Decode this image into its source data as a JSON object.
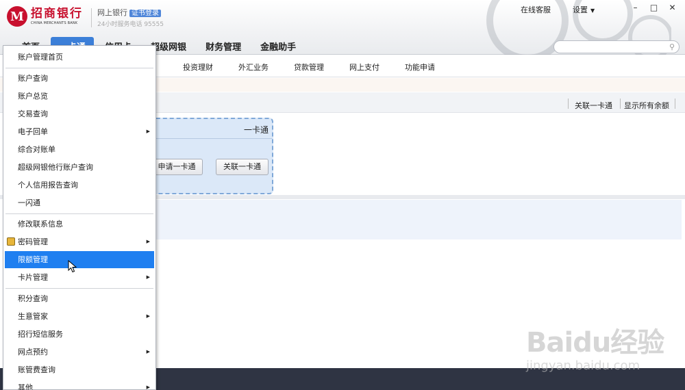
{
  "header": {
    "bank_logo_cn": "招商银行",
    "bank_logo_en": "CHINA MERCHANTS BANK",
    "ebank_label": "网上银行",
    "cert_login": "证书登录",
    "hotline": "24小时服务电话 95555",
    "online_service": "在线客服",
    "settings": "设置"
  },
  "main_nav": [
    "首页",
    "一卡通",
    "信用卡",
    "超级网银",
    "财务管理",
    "金融助手"
  ],
  "sub_nav": [
    "投资理财",
    "外汇业务",
    "贷款管理",
    "网上支付",
    "功能申请"
  ],
  "toolbar": {
    "link_card": "关联一卡通",
    "show_balance": "显示所有余额"
  },
  "card": {
    "title": "一卡通",
    "apply_button": "申请一卡通",
    "link_button": "关联一卡通"
  },
  "menu": {
    "items": [
      {
        "label": "账户管理首页"
      },
      {
        "label": "账户查询"
      },
      {
        "label": "账户总览"
      },
      {
        "label": "交易查询"
      },
      {
        "label": "电子回单",
        "submenu": true
      },
      {
        "label": "综合对账单"
      },
      {
        "label": "超级网银他行账户查询"
      },
      {
        "label": "个人信用报告查询"
      },
      {
        "label": "一闪通"
      },
      {
        "label": "修改联系信息"
      },
      {
        "label": "密码管理",
        "submenu": true,
        "icon": "lock-icon"
      },
      {
        "label": "限额管理",
        "highlighted": true
      },
      {
        "label": "卡片管理",
        "submenu": true
      },
      {
        "label": "积分查询"
      },
      {
        "label": "生意管家",
        "submenu": true
      },
      {
        "label": "招行短信服务"
      },
      {
        "label": "网点预约",
        "submenu": true
      },
      {
        "label": "账管费查询"
      },
      {
        "label": "其他",
        "submenu": true
      }
    ]
  },
  "watermark": {
    "main": "Baidu经验",
    "sub": "jingyan.baidu.com"
  },
  "colors": {
    "brand_red": "#c8102e",
    "nav_active": "#3c7fd8",
    "menu_highlight": "#1f7ff0",
    "footer": "#2f3443"
  }
}
